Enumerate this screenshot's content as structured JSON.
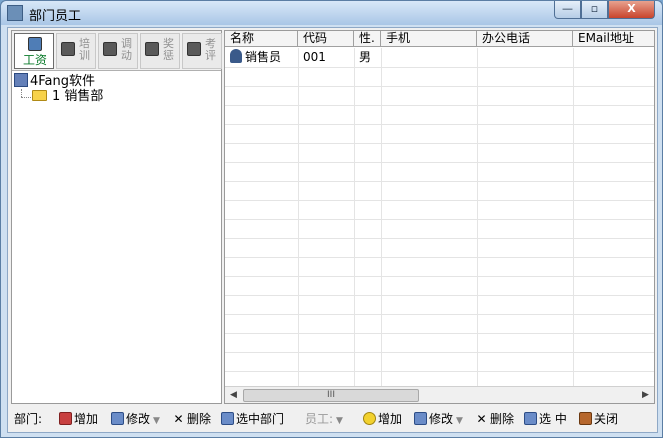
{
  "window": {
    "title": "部门员工",
    "btn_min": "—",
    "btn_max": "▫",
    "btn_close": "X"
  },
  "left_toolbar": {
    "buttons": [
      {
        "label": "工资",
        "active": true
      },
      {
        "label": "培训",
        "active": false
      },
      {
        "label": "调动",
        "active": false
      },
      {
        "label": "奖惩",
        "active": false
      },
      {
        "label": "考评",
        "active": false
      }
    ]
  },
  "tree": {
    "root": "4Fang软件",
    "child": "1 销售部"
  },
  "grid": {
    "columns": [
      "名称",
      "代码",
      "性.",
      "手机",
      "办公电话",
      "EMail地址"
    ],
    "rows": [
      {
        "name": "销售员",
        "code": "001",
        "sex": "男",
        "mobile": "",
        "office_phone": "",
        "email": ""
      }
    ],
    "scroll_thumb_grip": "III"
  },
  "bottom_toolbar": {
    "dept_label": "部门:",
    "dept_add": "增加",
    "dept_edit": "修改",
    "dept_delete": "删除",
    "dept_select": "选中部门",
    "emp_label": "员工:",
    "emp_add": "增加",
    "emp_edit": "修改",
    "emp_delete": "删除",
    "emp_select": "选 中",
    "close": "关闭"
  }
}
